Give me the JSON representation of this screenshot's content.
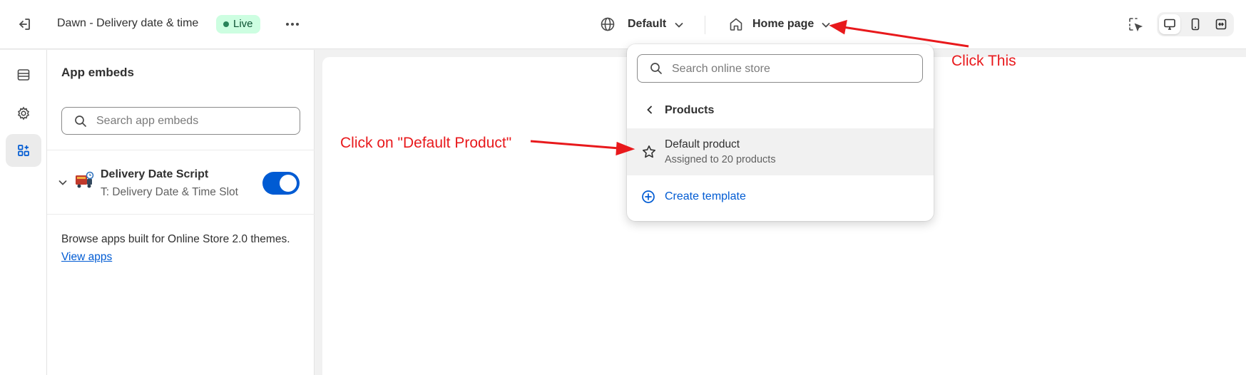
{
  "topbar": {
    "theme_title": "Dawn - Delivery date & time",
    "live_badge": "Live",
    "store_selector": "Default",
    "page_selector": "Home page"
  },
  "sidebar": {
    "title": "App embeds",
    "search_placeholder": "Search app embeds",
    "embed": {
      "name": "Delivery Date Script",
      "subtitle": "T: Delivery Date & Time Slot",
      "enabled": true
    },
    "browse_text": "Browse apps built for Online Store 2.0 themes.",
    "view_apps": "View apps"
  },
  "popover": {
    "search_placeholder": "Search online store",
    "section": "Products",
    "item": {
      "name": "Default product",
      "subtitle": "Assigned to 20 products"
    },
    "create": "Create template"
  },
  "annotations": {
    "click_this": "Click This",
    "click_default": "Click on \"Default Product\""
  },
  "colors": {
    "accent": "#005bd3",
    "annotation": "#e8191c",
    "live_bg": "#cdfee1"
  }
}
